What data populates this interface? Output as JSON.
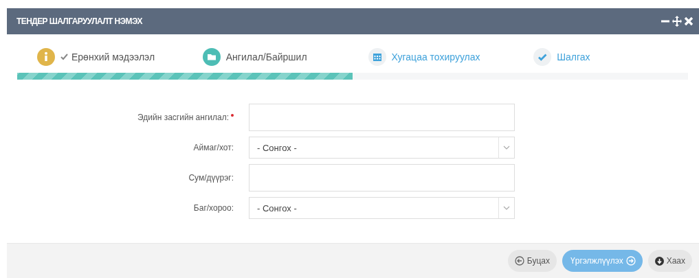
{
  "window": {
    "title": "ТЕНДЕР ШАЛГАРУУЛАЛТ НЭМЭХ"
  },
  "steps": [
    {
      "label": "Ерөнхий мэдээлэл",
      "kind": "info",
      "completed": true,
      "selected": false
    },
    {
      "label": "Ангилал/Байршил",
      "kind": "folder",
      "completed": false,
      "selected": true
    },
    {
      "label": "Хугацаа тохируулах",
      "kind": "calendar",
      "completed": false,
      "selected": false
    },
    {
      "label": "Шалгах",
      "kind": "check",
      "completed": false,
      "selected": false
    }
  ],
  "progress": {
    "level": 0.5
  },
  "fields": [
    {
      "label": "Эдийн засгийн ангилал:",
      "kind": "text",
      "required": true
    },
    {
      "label": "Аймаг/хот:",
      "kind": "select",
      "value": "- Сонгох -",
      "required": false
    },
    {
      "label": "Сум/дүүрэг:",
      "kind": "text",
      "required": false
    },
    {
      "label": "Баг/хороо:",
      "kind": "select",
      "value": "- Сонгох -",
      "required": false
    }
  ],
  "buttons": [
    {
      "label": "Буцах",
      "kind": "back"
    },
    {
      "label": "Үргэлжлүүлэх",
      "kind": "next"
    },
    {
      "label": "Хаах",
      "kind": "close"
    }
  ]
}
